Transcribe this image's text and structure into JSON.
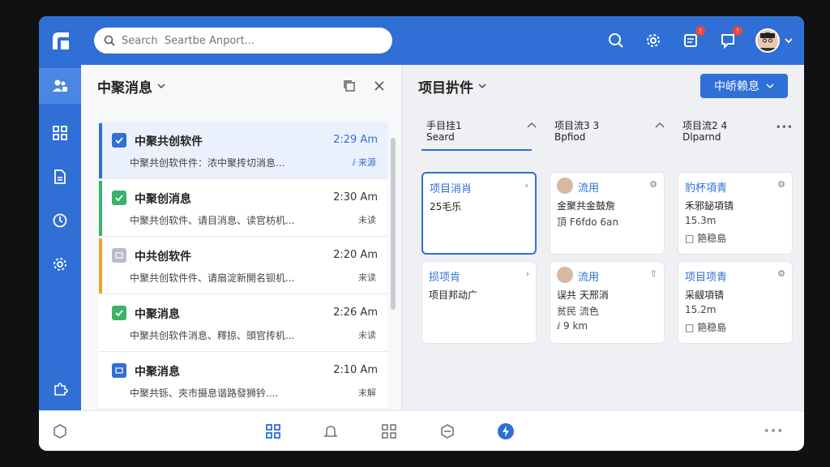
{
  "search": {
    "placeholder": "Search  Seartbe Anport..."
  },
  "left_panel": {
    "title": "中聚消息",
    "messages": [
      {
        "title": "中聚共创软件",
        "time": "2:29 Am",
        "subtitle": "中聚共创软件件：浓中聚抟切消息...",
        "tag": "ⅈ 来源",
        "bar_color": "#2f6fd6",
        "check_color": "#2f6fd6"
      },
      {
        "title": "中聚创消息",
        "time": "2:30 Am",
        "subtitle": "中聚共创软件、请目消息、读官枋机...",
        "tag": "未读",
        "bar_color": "#3bb36a",
        "check_color": "#3bb36a"
      },
      {
        "title": "中共创软件",
        "time": "2:20 Am",
        "subtitle": "中聚共创软件件、请扇淀新開名钡机...",
        "tag": "来读",
        "bar_color": "#f0a030",
        "check_color": "#b8bcc4"
      },
      {
        "title": "中聚消息",
        "time": "2:26 Am",
        "subtitle": "中聚共创软件消息、釋掠、頭官抟机...",
        "tag": "未读",
        "bar_color": "",
        "check_color": "#3bb36a"
      },
      {
        "title": "中聚消息",
        "time": "2:10 Am",
        "subtitle": "中聚共铄、夾市摄息谐路發狮钤....",
        "tag": "末解",
        "bar_color": "",
        "check_color": "#2f6fd6"
      }
    ]
  },
  "right_panel": {
    "title": "项目扸件",
    "button_label": "中峤赖息",
    "columns": [
      {
        "title": "手目挂1",
        "sub": "Seard"
      },
      {
        "title": "项目流3 3",
        "sub": "Bpfiod"
      },
      {
        "title": "项目流2 4",
        "sub": "Dlparnd"
      }
    ],
    "cards": [
      {
        "title": "项目消肖",
        "l1": "25毛乐",
        "l2": "",
        "l3": ""
      },
      {
        "title": "流用",
        "l1": "金聚共金鼓詹",
        "l2": "頂𫕷 F6fdo 6an",
        "l3": ""
      },
      {
        "title": "豹杯項青",
        "l1": "禾邪鉍項锖",
        "l2": "15.3m",
        "l3": "□ 筢稳島"
      },
      {
        "title": "损项肯",
        "l1": "项目邦动广",
        "l2": "",
        "l3": ""
      },
      {
        "title": "流用",
        "l1": "误共 天邢消",
        "l2": "贫民 流色",
        "l3": "ⅈ 9 km"
      },
      {
        "title": "项目项青",
        "l1": "采觎項锖",
        "l2": "15.2m",
        "l3": "□ 筢稳島"
      }
    ]
  },
  "colors": {
    "brand": "#2f6fd6",
    "badge": "#e8483d"
  }
}
